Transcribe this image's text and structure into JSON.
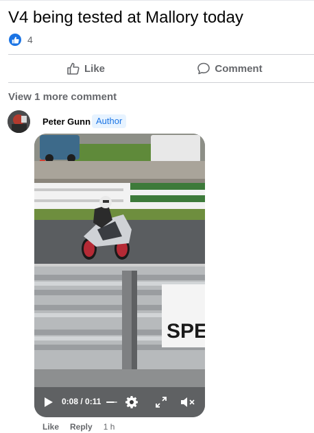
{
  "post": {
    "title": "V4 being tested at Mallory today",
    "reaction_count": "4"
  },
  "actions": {
    "like_label": "Like",
    "comment_label": "Comment"
  },
  "comments": {
    "view_more_label": "View 1 more comment"
  },
  "comment": {
    "author_name": "Peter Gunn",
    "author_badge": "Author",
    "video": {
      "time_display": "0:08 / 0:11",
      "progress_fraction": 0.727,
      "controls": [
        "play-icon",
        "settings-gear-icon",
        "fullscreen-icon",
        "volume-muted-icon"
      ],
      "overlay_sign_text": "SPEC"
    },
    "like_label": "Like",
    "reply_label": "Reply",
    "timestamp": "1 h"
  },
  "colors": {
    "accent": "#1b74e4",
    "secondary_text": "#65676b",
    "divider": "#ced0d4",
    "badge_bg": "#e7f3ff"
  }
}
